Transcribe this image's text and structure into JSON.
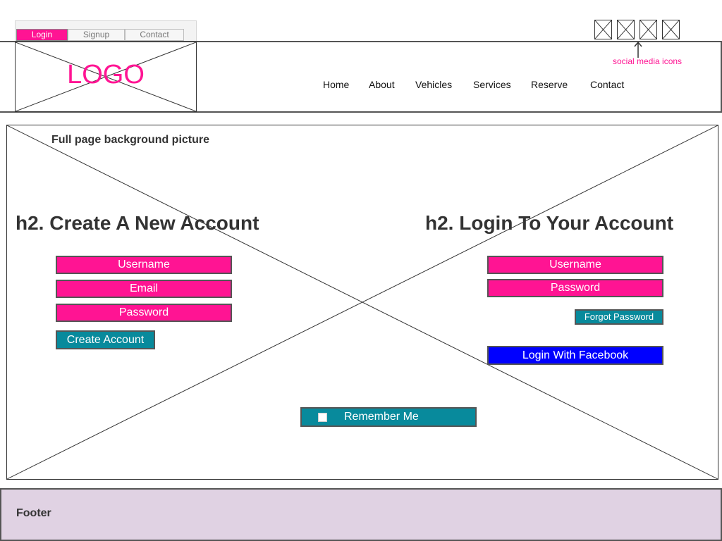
{
  "tabs": [
    {
      "label": "Login",
      "active": true
    },
    {
      "label": "Signup",
      "active": false
    },
    {
      "label": "Contact",
      "active": false
    }
  ],
  "logo": {
    "text": "LOGO"
  },
  "nav": {
    "items": [
      "Home",
      "About",
      "Vehicles",
      "Services",
      "Reserve",
      "Contact"
    ]
  },
  "social": {
    "icons": [
      "social-icon-1",
      "social-icon-2",
      "social-icon-3",
      "social-icon-4"
    ],
    "note": "social media icons"
  },
  "main": {
    "background_label": "Full page background picture",
    "create": {
      "heading": "h2. Create A New Account",
      "fields": [
        "Username",
        "Email",
        "Password"
      ],
      "button": "Create Account"
    },
    "login": {
      "heading": "h2. Login To Your Account",
      "fields": [
        "Username",
        "Password"
      ],
      "forgot": "Forgot Password",
      "facebook": "Login With Facebook"
    },
    "remember": "Remember Me"
  },
  "footer": {
    "text": "Footer"
  },
  "colors": {
    "accent_pink": "#ff1493",
    "teal": "#088a9c",
    "blue": "#0000ff",
    "footer_bg": "#e0d2e3"
  }
}
